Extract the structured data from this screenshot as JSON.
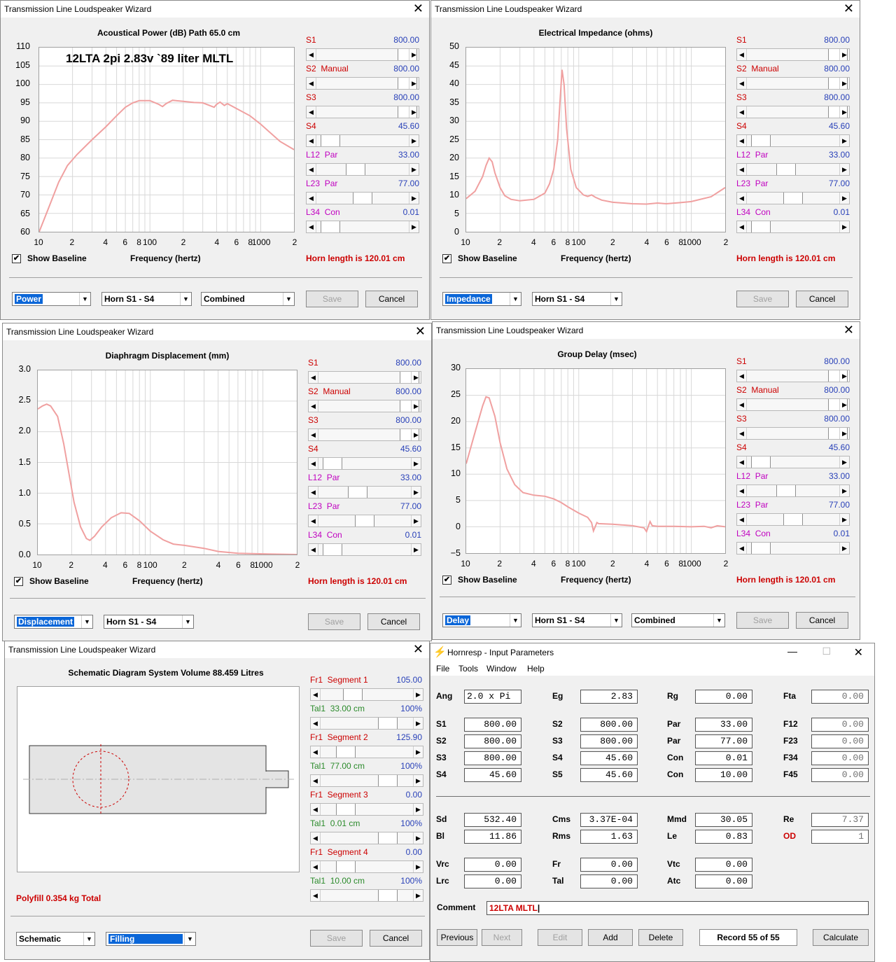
{
  "common": {
    "window_title": "Transmission Line Loudspeaker Wizard",
    "close": "✕",
    "show_baseline": "Show Baseline",
    "freq_label": "Frequency (hertz)",
    "horn_length": "Horn length is 120.01 cm",
    "save": "Save",
    "cancel": "Cancel",
    "horn_select": "Horn S1 - S4",
    "combined": "Combined",
    "x_ticks": [
      "10",
      "2",
      "4",
      "6",
      "8",
      "100",
      "2",
      "4",
      "6",
      "8",
      "1000",
      "2"
    ],
    "sliders": [
      {
        "name": "S1",
        "extra": "",
        "value": "800.00"
      },
      {
        "name": "S2",
        "extra": "Manual",
        "value": "800.00"
      },
      {
        "name": "S3",
        "extra": "",
        "value": "800.00"
      },
      {
        "name": "S4",
        "extra": "",
        "value": "45.60"
      },
      {
        "name": "L12",
        "extra": "Par",
        "value": "33.00"
      },
      {
        "name": "L23",
        "extra": "Par",
        "value": "77.00"
      },
      {
        "name": "L34",
        "extra": "Con",
        "value": "0.01"
      }
    ]
  },
  "power": {
    "title": "Acoustical Power (dB)   Path 65.0 cm",
    "annotation": "12LTA 2pi 2.83v  `89 liter MLTL",
    "y_ticks": [
      "110",
      "105",
      "100",
      "95",
      "90",
      "85",
      "80",
      "75",
      "70",
      "65",
      "60"
    ],
    "mode": "Power"
  },
  "impedance": {
    "title": "Electrical Impedance (ohms)",
    "y_ticks": [
      "50",
      "45",
      "40",
      "35",
      "30",
      "25",
      "20",
      "15",
      "10",
      "5",
      "0"
    ],
    "mode": "Impedance"
  },
  "displacement": {
    "title": "Diaphragm Displacement (mm)",
    "y_ticks": [
      "3.0",
      "2.5",
      "2.0",
      "1.5",
      "1.0",
      "0.5",
      "0.0"
    ],
    "mode": "Displacement"
  },
  "delay": {
    "title": "Group Delay (msec)",
    "y_ticks": [
      "30",
      "25",
      "20",
      "15",
      "10",
      "5",
      "0",
      "−5"
    ],
    "mode": "Delay"
  },
  "schematic": {
    "title": "Schematic Diagram   System Volume 88.459 Litres",
    "polyfill": "Polyfill   0.354 kg   Total",
    "mode": "Schematic",
    "fill": "Filling",
    "sliders": [
      {
        "name": "Fr1",
        "extra": "Segment 1",
        "value": "105.00"
      },
      {
        "name": "Tal1",
        "extra": "33.00 cm",
        "value": "100%"
      },
      {
        "name": "Fr1",
        "extra": "Segment 2",
        "value": "125.90"
      },
      {
        "name": "Tal1",
        "extra": "77.00 cm",
        "value": "100%"
      },
      {
        "name": "Fr1",
        "extra": "Segment 3",
        "value": "0.00"
      },
      {
        "name": "Tal1",
        "extra": "0.01 cm",
        "value": "100%"
      },
      {
        "name": "Fr1",
        "extra": "Segment 4",
        "value": "0.00"
      },
      {
        "name": "Tal1",
        "extra": "10.00 cm",
        "value": "100%"
      }
    ]
  },
  "hornresp": {
    "title": "Hornresp - Input Parameters",
    "menu": [
      "File",
      "Tools",
      "Window",
      "Help"
    ],
    "rows": [
      [
        [
          "Ang",
          "2.0 x Pi"
        ],
        [
          "Eg",
          "2.83"
        ],
        [
          "Rg",
          "0.00"
        ],
        [
          "Fta",
          "0.00"
        ]
      ],
      [
        [
          "S1",
          "800.00"
        ],
        [
          "S2",
          "800.00"
        ],
        [
          "Par",
          "33.00"
        ],
        [
          "F12",
          "0.00"
        ]
      ],
      [
        [
          "S2",
          "800.00"
        ],
        [
          "S3",
          "800.00"
        ],
        [
          "Par",
          "77.00"
        ],
        [
          "F23",
          "0.00"
        ]
      ],
      [
        [
          "S3",
          "800.00"
        ],
        [
          "S4",
          "45.60"
        ],
        [
          "Con",
          "0.01"
        ],
        [
          "F34",
          "0.00"
        ]
      ],
      [
        [
          "S4",
          "45.60"
        ],
        [
          "S5",
          "45.60"
        ],
        [
          "Con",
          "10.00"
        ],
        [
          "F45",
          "0.00"
        ]
      ],
      [
        [
          "Sd",
          "532.40"
        ],
        [
          "Cms",
          "3.37E-04"
        ],
        [
          "Mmd",
          "30.05"
        ],
        [
          "Re",
          "7.37"
        ]
      ],
      [
        [
          "Bl",
          "11.86"
        ],
        [
          "Rms",
          "1.63"
        ],
        [
          "Le",
          "0.83"
        ],
        [
          "OD",
          "1"
        ]
      ],
      [
        [
          "Vrc",
          "0.00"
        ],
        [
          "Fr",
          "0.00"
        ],
        [
          "Vtc",
          "0.00"
        ]
      ],
      [
        [
          "Lrc",
          "0.00"
        ],
        [
          "Tal",
          "0.00"
        ],
        [
          "Atc",
          "0.00"
        ]
      ]
    ],
    "comment_label": "Comment",
    "comment": "12LTA MLTL",
    "buttons": [
      "Previous",
      "Next",
      "Edit",
      "Add",
      "Delete"
    ],
    "record": "Record 55 of 55",
    "calculate": "Calculate"
  },
  "colors": {
    "curve": "#f0a0a0",
    "slider_value": "#2840b8",
    "label_red": "#cc0000",
    "label_magenta": "#c000c0",
    "select_blue": "#0a66d8"
  }
}
